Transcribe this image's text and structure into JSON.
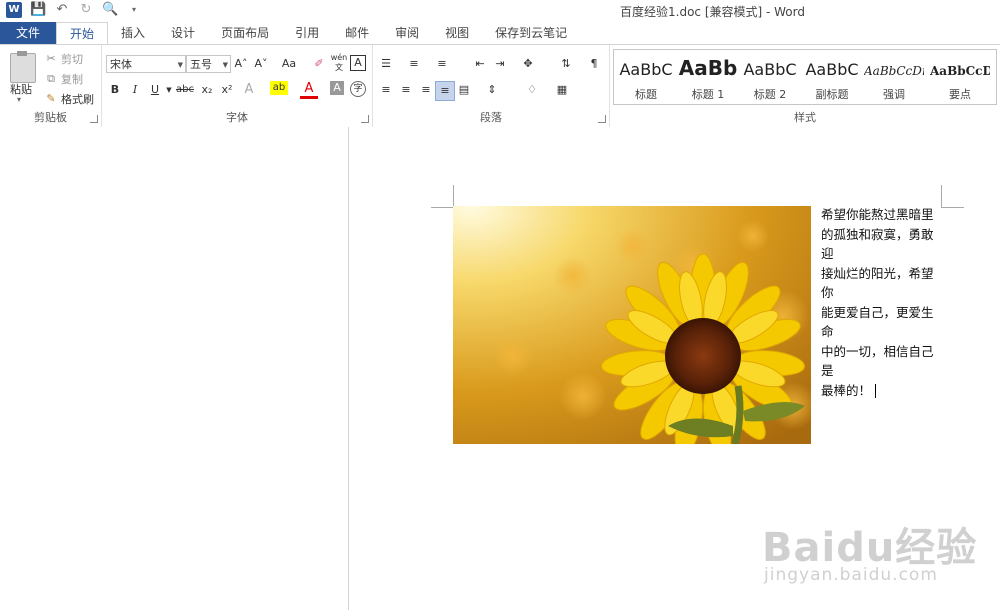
{
  "window": {
    "title": "百度经验1.doc [兼容模式] - Word"
  },
  "tabs": [
    "文件",
    "开始",
    "插入",
    "设计",
    "页面布局",
    "引用",
    "邮件",
    "审阅",
    "视图",
    "保存到云笔记"
  ],
  "clipboard": {
    "paste": "粘贴",
    "cut": "剪切",
    "copy": "复制",
    "format_painter": "格式刷",
    "label": "剪贴板"
  },
  "font": {
    "name": "宋体",
    "size": "五号",
    "label": "字体",
    "bold": "B",
    "italic": "I",
    "underline": "U",
    "strike": "abc",
    "sub": "x₂",
    "sup": "x²",
    "grow": "A˄",
    "shrink": "A˅",
    "case": "Aa",
    "phonetic": "wén",
    "border_char": "A",
    "effects": "A",
    "highlight": "ab",
    "color": "A",
    "shading": "A",
    "circle": "字"
  },
  "paragraph": {
    "label": "段落"
  },
  "styles": {
    "label": "样式",
    "items": [
      {
        "sample": "AaBbC",
        "name": "标题"
      },
      {
        "sample": "AaBb",
        "name": "标题 1"
      },
      {
        "sample": "AaBbC",
        "name": "标题 2"
      },
      {
        "sample": "AaBbC",
        "name": "副标题"
      },
      {
        "sample": "AaBbCcDı",
        "name": "强调"
      },
      {
        "sample": "AaBbCcD",
        "name": "要点"
      }
    ]
  },
  "document": {
    "lines": [
      "希望你能熬过黑暗里",
      "的孤独和寂寞，勇敢迎",
      "接灿烂的阳光，希望你",
      "能更爱自己，更爱生命",
      "中的一切，相信自己是",
      "最棒的！"
    ],
    "image": "sunflower-photo"
  },
  "watermark": {
    "brand": "Baidu经验",
    "url": "jingyan.baidu.com"
  },
  "colors": {
    "accent": "#2b579a",
    "highlight_yellow": "#ffff00",
    "font_red": "#e00000"
  }
}
